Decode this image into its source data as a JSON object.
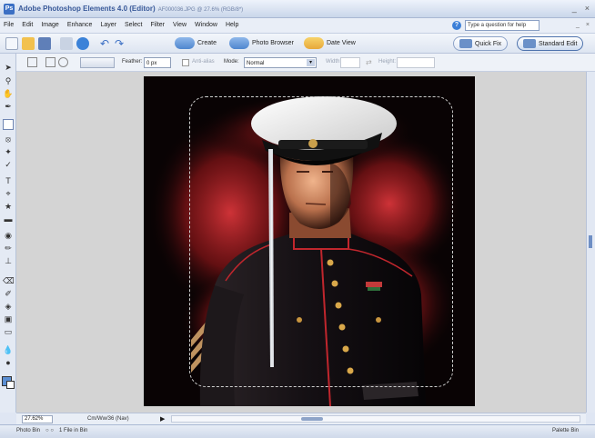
{
  "window": {
    "title": "Adobe Photoshop Elements 4.0 (Editor)",
    "file_info": "AF000036.JPG @ 27.6% (RGB/8*)",
    "controls": [
      "_",
      "×"
    ]
  },
  "menu": {
    "items": [
      "File",
      "Edit",
      "Image",
      "Enhance",
      "Layer",
      "Select",
      "Filter",
      "View",
      "Window",
      "Help"
    ],
    "help_placeholder": "Type a question for help"
  },
  "shortcuts": {
    "create": "Create",
    "photo_browser": "Photo Browser",
    "date_view": "Date View",
    "quick_fix": "Quick Fix",
    "standard_edit": "Standard Edit"
  },
  "options": {
    "feather_label": "Feather:",
    "feather_value": "0 px",
    "antialias_label": "Anti-alias",
    "mode_label": "Mode:",
    "mode_value": "Normal",
    "width_label": "Width:",
    "height_label": "Height:"
  },
  "status": {
    "zoom": "27.62%",
    "doc_size": "Cm/Ww/36 (Nav)"
  },
  "bin": {
    "label": "Photo Bin",
    "count": "1 File in Bin",
    "palette_bin": "Palette Bin"
  },
  "colors": {
    "accent": "#3b6fc4",
    "workspace": "#d4d4d4"
  }
}
